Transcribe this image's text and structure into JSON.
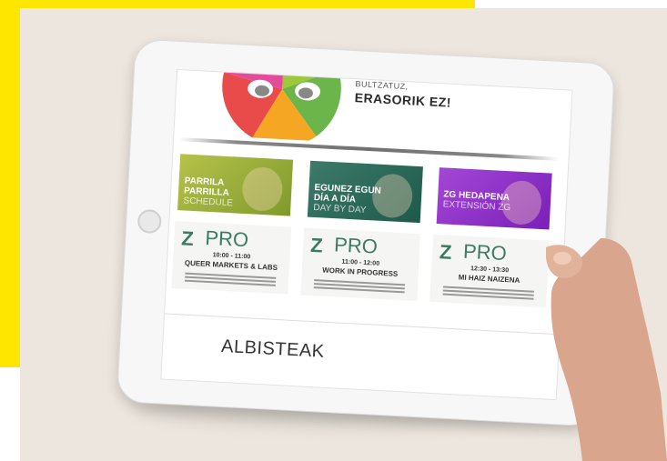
{
  "screen": {
    "tagline_small": "BULTZATUZ,",
    "tagline_big": "ERASORIK EZ!",
    "cards": [
      {
        "title1": "PARRILA",
        "title2": "PARRILLA",
        "sub": "SCHEDULE",
        "color": "#8fa737"
      },
      {
        "title1": "EGUNEZ EGUN",
        "title2": "DÍA A DÍA",
        "sub": "DAY BY DAY",
        "color": "#2c6a58"
      },
      {
        "title1": "ZG HEDAPENA",
        "title2": "",
        "sub": "EXTENSIÓN ZG",
        "color": "#8c2fc9"
      }
    ],
    "pro_cards": [
      {
        "brand": "PRO",
        "time": "10:00 - 11:00",
        "name": "QUEER MARKETS & LABS"
      },
      {
        "brand": "PRO",
        "time": "11:00 - 12:00",
        "name": "WORK IN PROGRESS"
      },
      {
        "brand": "PRO",
        "time": "12:30 - 13:30",
        "name": "MI HAIZ NAIZENA"
      }
    ],
    "news_heading": "ALBISTEAK"
  }
}
